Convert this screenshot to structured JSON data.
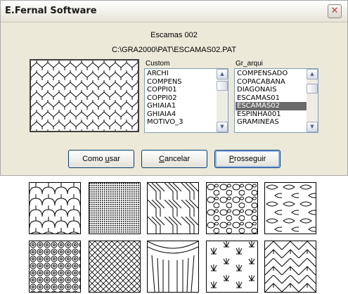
{
  "window": {
    "title": "E.Fernal Software",
    "close_glyph": "✕",
    "close_icon": "close-icon"
  },
  "pattern": {
    "name": "Escamas 002",
    "path": "C:\\GRA2000\\PAT\\ESCAMAS02.PAT"
  },
  "custom_list": {
    "label": "Custom",
    "items": [
      "ARCHI",
      "COMPENS",
      "COPPI01",
      "COPPI02",
      "GHIAIA1",
      "GHIAIA4",
      "MOTIVO_3"
    ],
    "selected": null
  },
  "gr_list": {
    "label": "Gr_arqui",
    "items": [
      "COMPENSADO",
      "COPACABANA",
      "DIAGONAIS",
      "ESCAMAS01",
      "ESCAMAS02",
      "ESPINHA001",
      "GRAMINEAS"
    ],
    "selected": "ESCAMAS02"
  },
  "buttons": {
    "how_to_use": {
      "pre": "Como ",
      "mn": "u",
      "post": "sar"
    },
    "cancel": {
      "pre": "",
      "mn": "C",
      "post": "ancelar"
    },
    "continue": {
      "pre": "",
      "mn": "P",
      "post": "rosseguir"
    }
  },
  "scroll_arrows": {
    "up": "▲",
    "down": "▼"
  },
  "sample_tiles": [
    "fish-scale-pattern",
    "dense-dot-pattern",
    "chevron-stripe-pattern",
    "stone-pattern",
    "leaf-pattern",
    "circle-grid-pattern",
    "diamond-lattice-pattern",
    "arch-stripe-pattern",
    "grass-pattern",
    "zigzag-brick-pattern"
  ]
}
